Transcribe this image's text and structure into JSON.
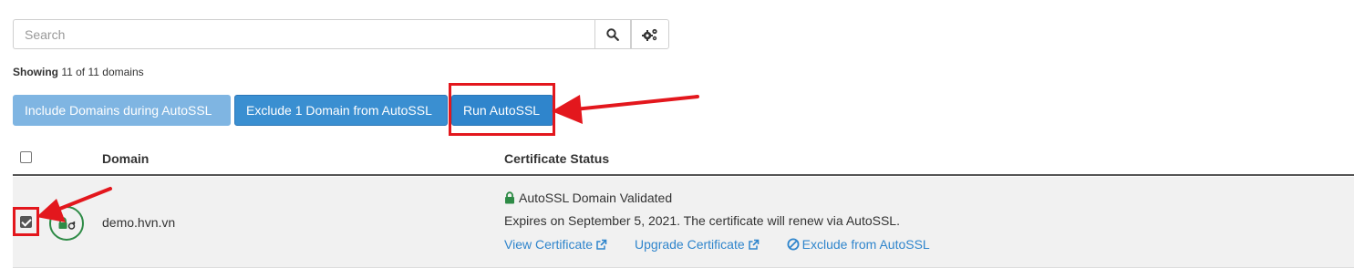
{
  "search": {
    "placeholder": "Search"
  },
  "showing": {
    "label": "Showing",
    "count_text": "11 of 11 domains"
  },
  "actions": {
    "include_label": "Include Domains during AutoSSL",
    "exclude_label": "Exclude 1 Domain from AutoSSL",
    "run_label": "Run AutoSSL"
  },
  "table": {
    "headers": {
      "domain": "Domain",
      "status": "Certificate Status"
    },
    "rows": [
      {
        "checked": true,
        "domain": "demo.hvn.vn",
        "status_title": "AutoSSL Domain Validated",
        "expires": "Expires on September 5, 2021. The certificate will renew via AutoSSL.",
        "link_view": "View Certificate",
        "link_upgrade": "Upgrade Certificate",
        "link_exclude": "Exclude from AutoSSL"
      }
    ]
  },
  "colors": {
    "primary": "#2f85cc",
    "disabled": "#7fb5e2",
    "valid": "#2e8b46",
    "annotation": "#e3171d"
  },
  "icons": [
    "search-icon",
    "gears-icon",
    "lock-icon",
    "external-link-icon",
    "ban-icon"
  ]
}
